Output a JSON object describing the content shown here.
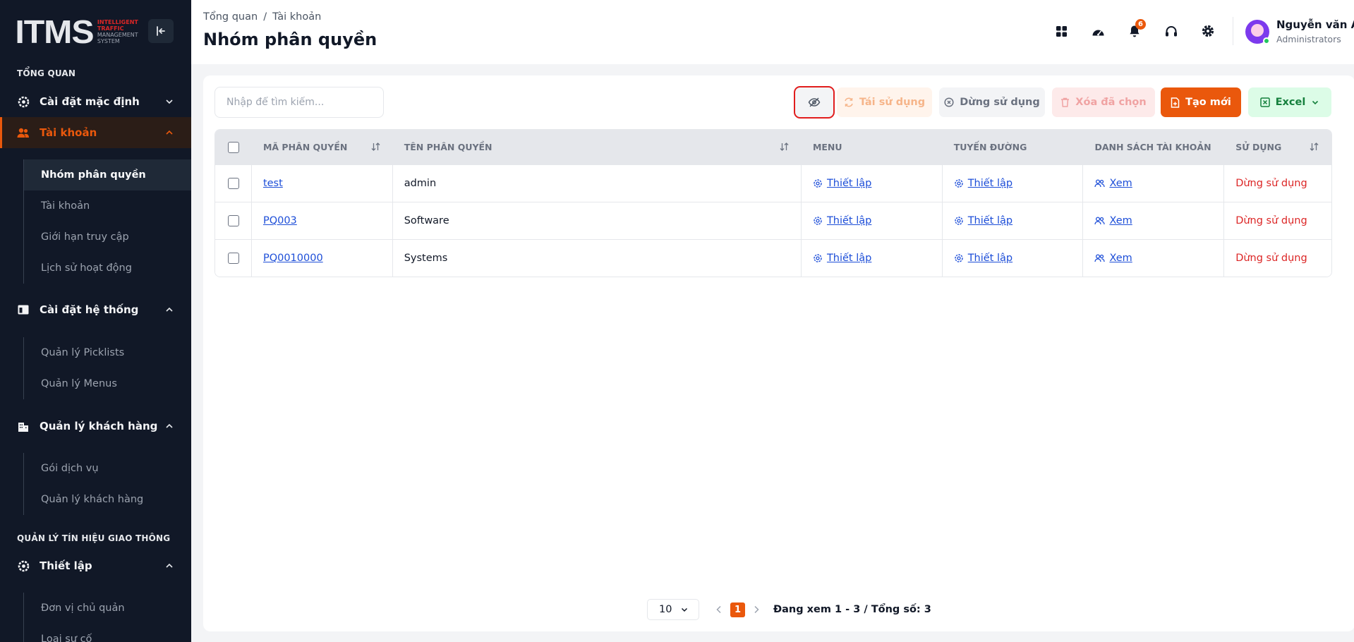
{
  "brand": {
    "logo": "ITMS",
    "sub1": "INTELLIGENT",
    "sub2": "TRAFFIC",
    "sub3": "MANAGEMENT",
    "sub4": "SYSTEM"
  },
  "sidebar": {
    "section_overview": "TỔNG QUAN",
    "section_signal": "QUẢN LÝ TÍN HIỆU GIAO THÔNG",
    "groups": [
      {
        "label": "Cài đặt mặc định"
      },
      {
        "label": "Tài khoản"
      },
      {
        "label": "Cài đặt hệ thống"
      },
      {
        "label": "Quản lý khách hàng"
      },
      {
        "label": "Thiết lập"
      }
    ],
    "account_items": [
      "Nhóm phân quyền",
      "Tài khoản",
      "Giới hạn truy cập",
      "Lịch sử hoạt động"
    ],
    "system_items": [
      "Quản lý Picklists",
      "Quản lý Menus"
    ],
    "customer_items": [
      "Gói dịch vụ",
      "Quản lý khách hàng"
    ],
    "setup_items": [
      "Đơn vị chủ quản",
      "Loại sự cố"
    ]
  },
  "header": {
    "breadcrumb_root": "Tổng quan",
    "breadcrumb_sep": "/",
    "breadcrumb_current": "Tài khoản",
    "title": "Nhóm phân quyền",
    "notification_count": "6",
    "user_name": "Nguyễn văn A",
    "user_role": "Administrators"
  },
  "toolbar": {
    "search_placeholder": "Nhập để tìm kiếm...",
    "reuse": "Tái sử dụng",
    "stop": "Dừng sử dụng",
    "delete": "Xóa đã chọn",
    "create": "Tạo mới",
    "excel": "Excel"
  },
  "table": {
    "headers": [
      "MÃ PHÂN QUYỀN",
      "TÊN PHÂN QUYỀN",
      "MENU",
      "TUYẾN ĐƯỜNG",
      "DANH SÁCH TÀI KHOẢN",
      "SỬ DỤNG"
    ],
    "rows": [
      {
        "code": "test",
        "name": "admin",
        "menu": "Thiết lập",
        "route": "Thiết lập",
        "accounts": "Xem",
        "status": "Dừng sử dụng"
      },
      {
        "code": "PQ003",
        "name": "Software",
        "menu": "Thiết lập",
        "route": "Thiết lập",
        "accounts": "Xem",
        "status": "Dừng sử dụng"
      },
      {
        "code": "PQ0010000",
        "name": "Systems",
        "menu": "Thiết lập",
        "route": "Thiết lập",
        "accounts": "Xem",
        "status": "Dừng sử dụng"
      }
    ]
  },
  "pagination": {
    "page_size": "10",
    "current_page": "1",
    "info": "Đang xem 1 - 3 / Tổng số: 3"
  },
  "colors": {
    "accent": "#ea580c",
    "sidebar_bg": "#111827",
    "link": "#1d4ed8",
    "danger": "#dc2626",
    "excel": "#15803d"
  }
}
